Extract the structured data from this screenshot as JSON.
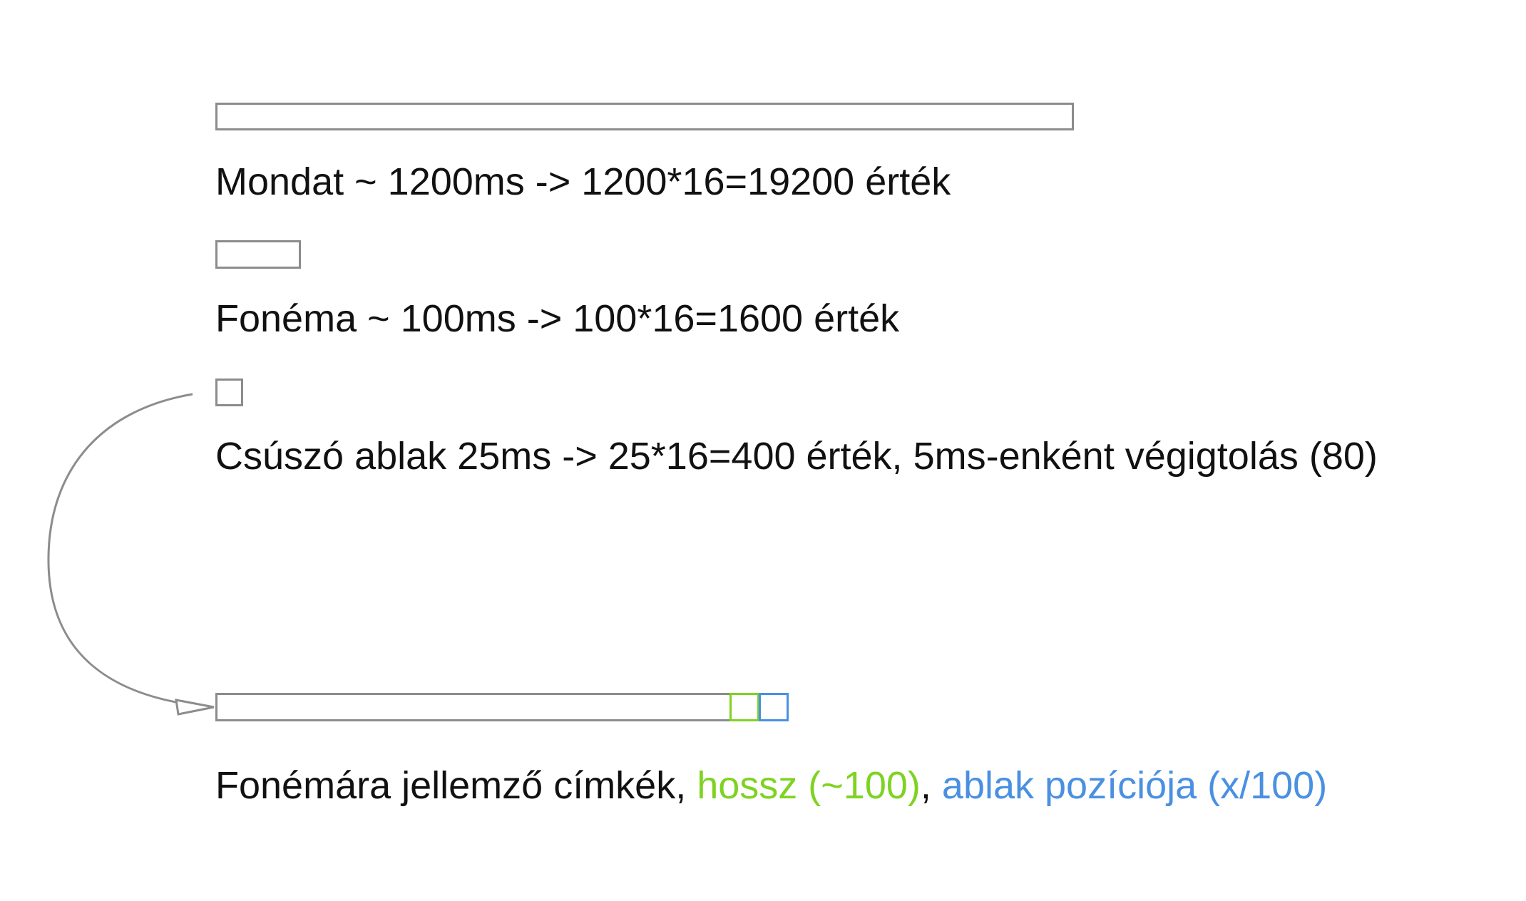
{
  "rows": {
    "sentence": {
      "text": "Mondat ~ 1200ms -> 1200*16=19200 érték"
    },
    "phoneme": {
      "text": "Fonéma ~ 100ms -> 100*16=1600 érték"
    },
    "sliding_window": {
      "text": "Csúszó ablak 25ms -> 25*16=400 érték, 5ms-enként végigtolás (80)"
    }
  },
  "features": {
    "prefix": "Fonémára jellemző címkék, ",
    "length": "hossz (~100)",
    "separator": ", ",
    "position": "ablak pozíciója (x/100)"
  },
  "colors": {
    "outline": "#8c8c8c",
    "length": "#7ed321",
    "position": "#4a90e2",
    "text": "#111111"
  }
}
